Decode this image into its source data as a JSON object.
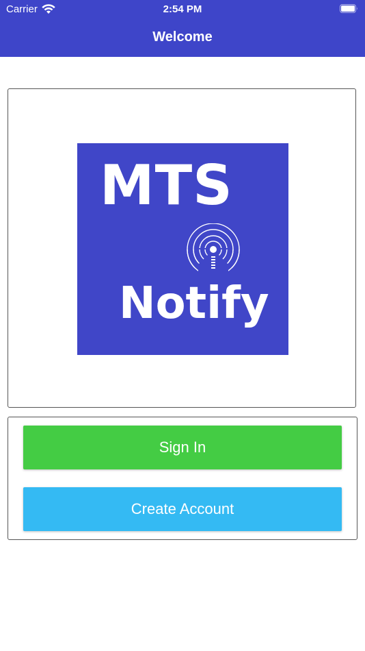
{
  "status_bar": {
    "carrier": "Carrier",
    "time": "2:54 PM",
    "wifi_icon": "wifi-icon",
    "battery_icon": "battery-icon"
  },
  "navbar": {
    "title": "Welcome",
    "color": "#3e45c9"
  },
  "logo": {
    "line1": "MTS",
    "line2": "Notify",
    "background": "#4046c8",
    "icon": "signal-tower-icon"
  },
  "buttons": {
    "sign_in": {
      "label": "Sign In",
      "color": "#44cc44"
    },
    "create_account": {
      "label": "Create Account",
      "color": "#34baf3"
    }
  }
}
